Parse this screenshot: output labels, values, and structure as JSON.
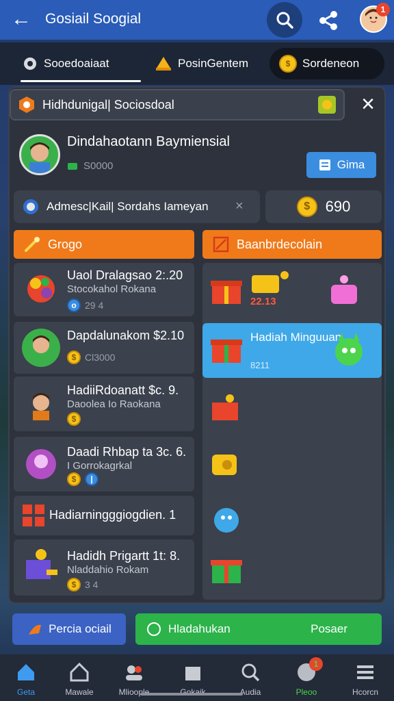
{
  "header": {
    "title": "Gosiail Soogial",
    "notif_count": "1"
  },
  "tabs": [
    {
      "label": "Sooedoaiaat"
    },
    {
      "label": "PosinGentem"
    },
    {
      "label": "Sordeneon"
    }
  ],
  "section_header": {
    "label": "Hidhdunigal| Sociosdoal"
  },
  "profile": {
    "name": "Dindahaotann Baymiensial",
    "score": "S0000",
    "action_label": "Gima"
  },
  "search": {
    "value": "Admesc|Kail| Sordahs Iameyan"
  },
  "coins": {
    "value": "690"
  },
  "left_column": {
    "header": "Grogo",
    "items": [
      {
        "title": "Uaol Dralagsao 2:.20",
        "subtitle": "Stocokahol Rokana",
        "meta": "29 4"
      },
      {
        "title": "Dapdalunakom $2.10",
        "meta": "Cl3000"
      },
      {
        "title": "HadiiRdoanatt $c. 9.",
        "subtitle": "Daoolea Io Raokana"
      },
      {
        "title": "Daadi Rhbap ta 3c. 6.",
        "subtitle": "I Gorrokagrkal"
      },
      {
        "title": "Hadiarningggiogdien. 1"
      },
      {
        "title": "Hadidh Prigartt 1t: 8.",
        "subtitle": "Nladdahio Rokam",
        "meta": "3 4"
      }
    ]
  },
  "right_column": {
    "header": "Baanbrdecolain",
    "top_value": "22.13",
    "highlight": {
      "title": "Hadiah Minguuan",
      "sub": "8211"
    }
  },
  "buttons": {
    "left": "Percia ociail",
    "right_left": "Hladahukan",
    "right_right": "Posaer"
  },
  "nav": {
    "items": [
      {
        "label": "Geta"
      },
      {
        "label": "Mawale"
      },
      {
        "label": "Mlioople"
      },
      {
        "label": "Gokaik"
      },
      {
        "label": "Audia"
      },
      {
        "label": "Pleoo"
      },
      {
        "label": "Hcorcn"
      }
    ],
    "badge": "1"
  },
  "colors": {
    "accent": "#2a5cb8",
    "orange": "#f07a1a",
    "green": "#2cb34a",
    "blue": "#3fa8e8"
  }
}
